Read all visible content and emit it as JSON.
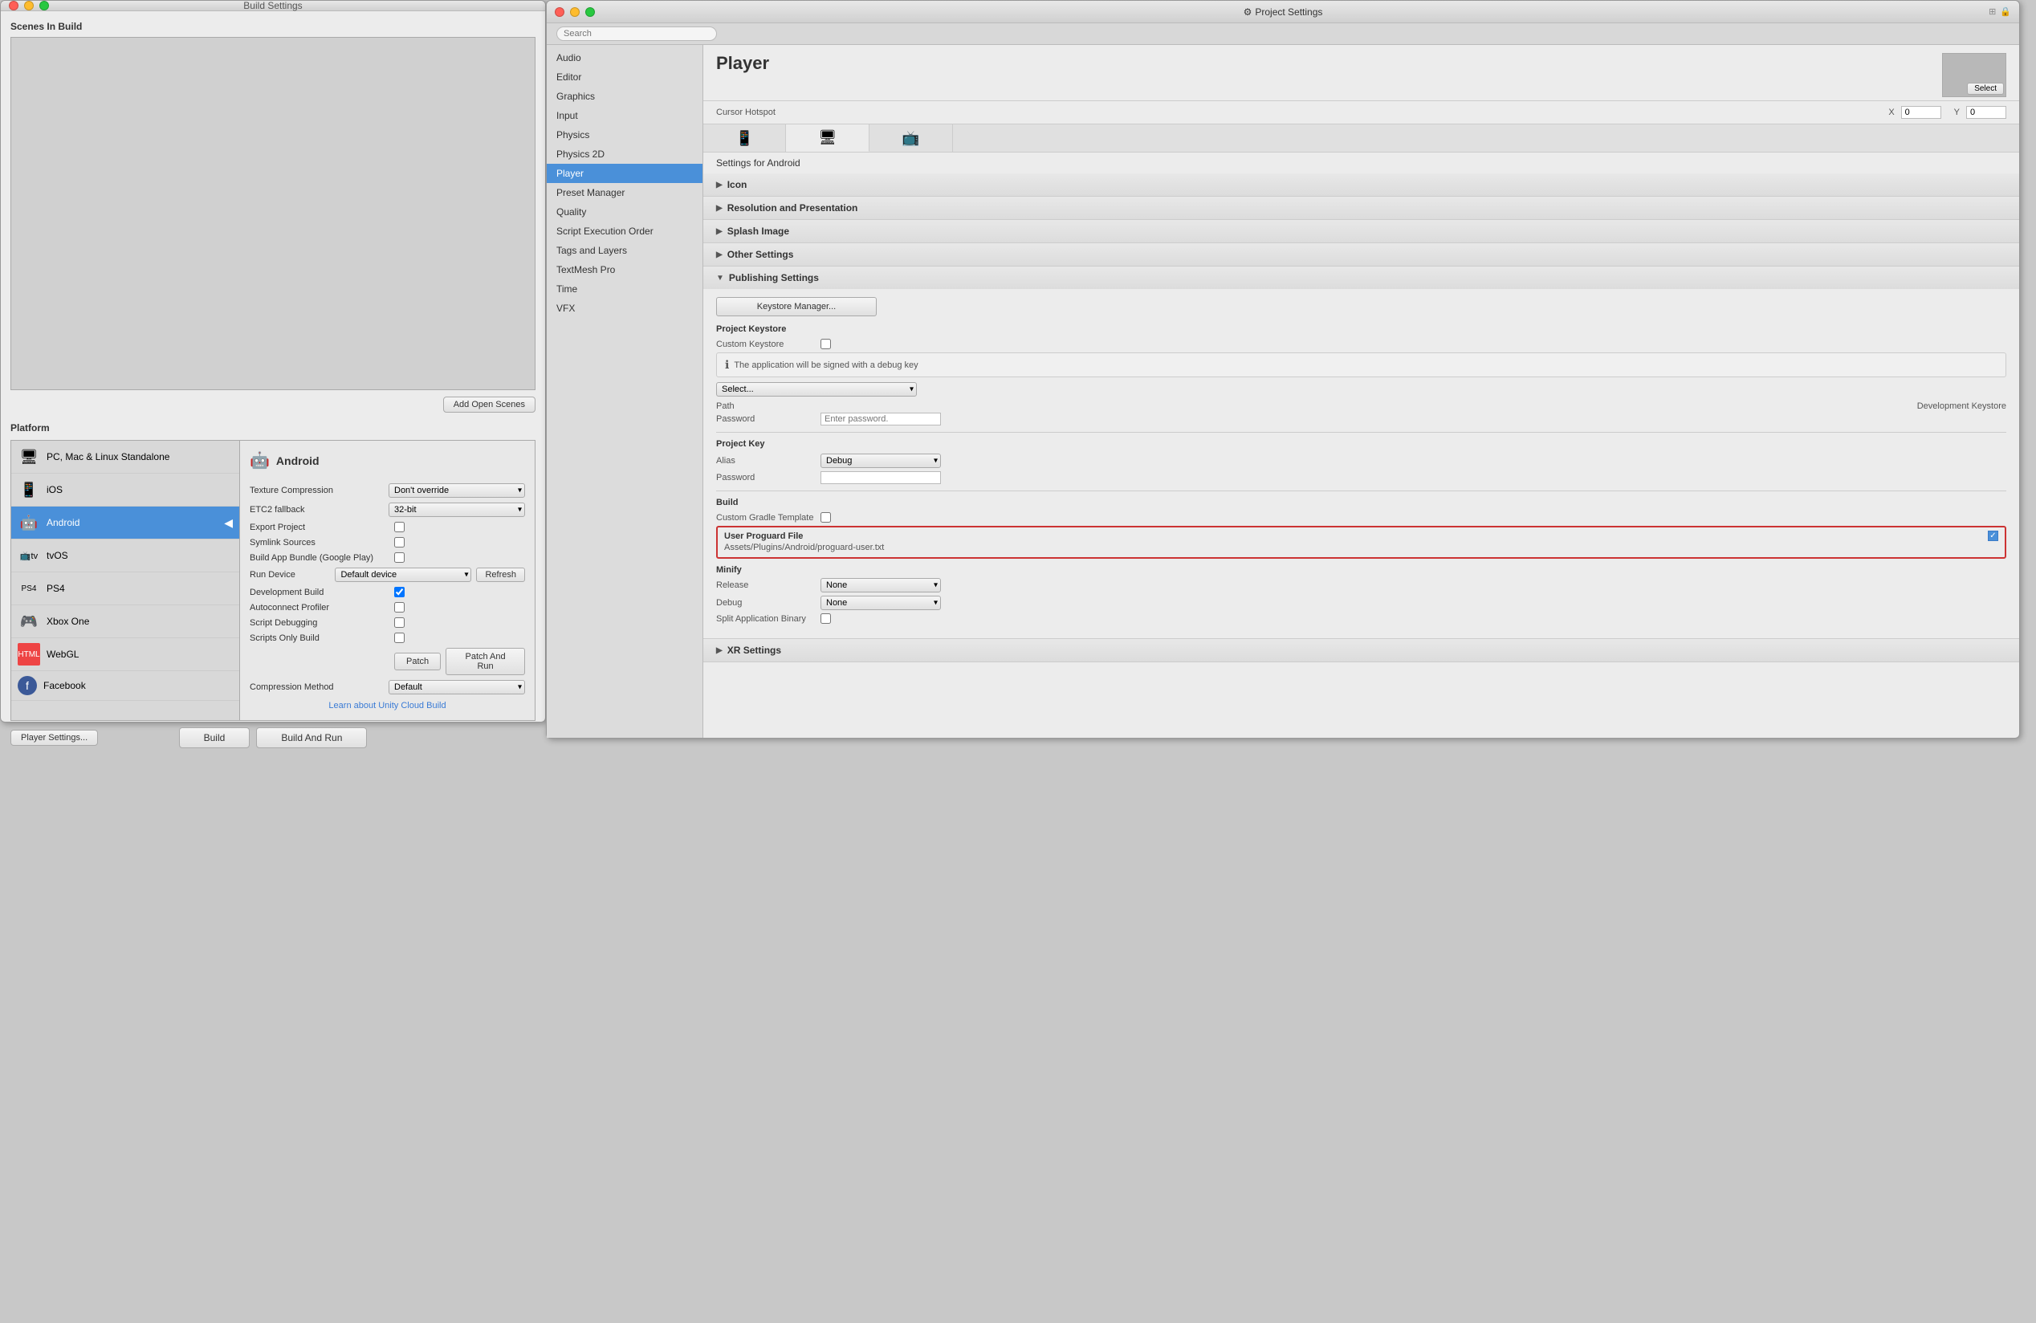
{
  "buildSettings": {
    "title": "Build Settings",
    "scenesInBuild": "Scenes In Build",
    "addOpenScenesBtn": "Add Open Scenes",
    "platform": "Platform",
    "platforms": [
      {
        "id": "pc",
        "name": "PC, Mac & Linux Standalone",
        "icon": "🖥"
      },
      {
        "id": "ios",
        "name": "iOS",
        "icon": "📱"
      },
      {
        "id": "android",
        "name": "Android",
        "icon": "🤖",
        "selected": true
      },
      {
        "id": "tvos",
        "name": "tvOS",
        "icon": "📺"
      },
      {
        "id": "ps4",
        "name": "PS4",
        "icon": "🎮"
      },
      {
        "id": "xbox",
        "name": "Xbox One",
        "icon": "🎮"
      },
      {
        "id": "webgl",
        "name": "WebGL",
        "icon": "🌐"
      },
      {
        "id": "facebook",
        "name": "Facebook",
        "icon": "📘"
      }
    ],
    "android": {
      "name": "Android",
      "textureCompression": {
        "label": "Texture Compression",
        "value": "Don't override"
      },
      "etc2Fallback": {
        "label": "ETC2 fallback",
        "value": "32-bit"
      },
      "exportProject": {
        "label": "Export Project"
      },
      "symlinkSources": {
        "label": "Symlink Sources"
      },
      "buildAppBundle": {
        "label": "Build App Bundle (Google Play)"
      },
      "runDevice": {
        "label": "Run Device",
        "value": "Default device",
        "refreshBtn": "Refresh"
      },
      "developmentBuild": {
        "label": "Development Build",
        "checked": true
      },
      "autoconnectProfiler": {
        "label": "Autoconnect Profiler"
      },
      "scriptDebugging": {
        "label": "Script Debugging"
      },
      "scriptsOnlyBuild": {
        "label": "Scripts Only Build",
        "patchBtn": "Patch",
        "patchAndRunBtn": "Patch And Run"
      },
      "compressionMethod": {
        "label": "Compression Method",
        "value": "Default"
      }
    },
    "cloudBuildLink": "Learn about Unity Cloud Build",
    "buildBtn": "Build",
    "buildAndRunBtn": "Build And Run",
    "playerSettingsBtn": "Player Settings..."
  },
  "projectSettings": {
    "title": "Project Settings",
    "searchPlaceholder": "Search",
    "navItems": [
      {
        "id": "audio",
        "label": "Audio"
      },
      {
        "id": "editor",
        "label": "Editor"
      },
      {
        "id": "graphics",
        "label": "Graphics"
      },
      {
        "id": "input",
        "label": "Input"
      },
      {
        "id": "physics",
        "label": "Physics"
      },
      {
        "id": "physics2d",
        "label": "Physics 2D"
      },
      {
        "id": "player",
        "label": "Player",
        "active": true
      },
      {
        "id": "presetmanager",
        "label": "Preset Manager"
      },
      {
        "id": "quality",
        "label": "Quality"
      },
      {
        "id": "scriptexecution",
        "label": "Script Execution Order"
      },
      {
        "id": "tagsandlayers",
        "label": "Tags and Layers"
      },
      {
        "id": "textmeshpro",
        "label": "TextMesh Pro"
      },
      {
        "id": "time",
        "label": "Time"
      },
      {
        "id": "vfx",
        "label": "VFX"
      }
    ],
    "player": {
      "title": "Player",
      "cursorHotspot": "Cursor Hotspot",
      "xLabel": "X",
      "xValue": "0",
      "yLabel": "Y",
      "yValue": "0",
      "selectBtn": "Select",
      "settingsForAndroid": "Settings for Android",
      "tabs": [
        {
          "id": "mobile",
          "icon": "📱"
        },
        {
          "id": "tablet",
          "icon": "🖥"
        },
        {
          "id": "tv",
          "icon": "📺"
        }
      ],
      "sections": [
        {
          "id": "icon",
          "label": "Icon"
        },
        {
          "id": "resolution",
          "label": "Resolution and Presentation"
        },
        {
          "id": "splash",
          "label": "Splash Image"
        },
        {
          "id": "other",
          "label": "Other Settings"
        }
      ],
      "publishing": {
        "sectionLabel": "Publishing Settings",
        "keystoreManagerBtn": "Keystore Manager...",
        "projectKeystore": "Project Keystore",
        "customKeystore": "Custom Keystore",
        "debugKeyNotice": "The application will be signed with a debug key",
        "selectPlaceholder": "Select...",
        "pathLabel": "Path",
        "developmentKeystore": "Development Keystore",
        "passwordLabel": "Password",
        "enterPassword": "Enter password.",
        "projectKey": "Project Key",
        "aliasLabel": "Alias",
        "aliasValue": "Debug",
        "passwordLabel2": "Password"
      },
      "build": {
        "sectionLabel": "Build",
        "customGradleTemplate": "Custom Gradle Template",
        "userProguardFile": "User Proguard File",
        "proguardPath": "Assets/Plugins/Android/proguard-user.txt",
        "minify": "Minify",
        "releaseLabel": "Release",
        "releaseValue": "None",
        "debugLabel": "Debug",
        "debugValue": "None",
        "splitApplicationBinary": "Split Application Binary"
      },
      "xrSettings": {
        "label": "XR Settings"
      }
    }
  }
}
